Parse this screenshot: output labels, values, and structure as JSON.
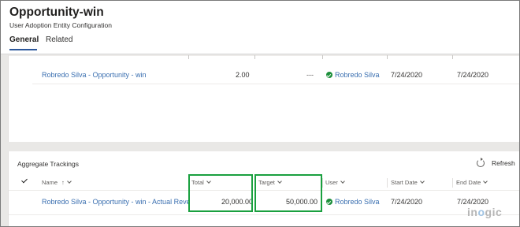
{
  "header": {
    "title": "Opportunity-win",
    "subtitle": "User Adoption Entity Configuration",
    "tabs": [
      {
        "label": "General",
        "active": true
      },
      {
        "label": "Related",
        "active": false
      }
    ]
  },
  "top_grid": {
    "row": {
      "name": "Robredo Silva - Opportunity - win",
      "value": "2.00",
      "target": "---",
      "user": "Robredo Silva",
      "start_date": "7/24/2020",
      "end_date": "7/24/2020"
    }
  },
  "aggregate": {
    "title": "Aggregate Trackings",
    "refresh_label": "Refresh",
    "columns": {
      "name": "Name",
      "name_sort": "↑",
      "total": "Total",
      "target": "Target",
      "user": "User",
      "start_date": "Start Date",
      "end_date": "End Date"
    },
    "row": {
      "name": "Robredo Silva - Opportunity - win - Actual Revenu",
      "total": "20,000.00",
      "target": "50,000.00",
      "user": "Robredo Silva",
      "start_date": "7/24/2020",
      "end_date": "7/24/2020"
    }
  },
  "watermark": {
    "prefix": "in",
    "o": "o",
    "suffix": "gic"
  },
  "colors": {
    "link": "#3a6fb0",
    "status_active": "#1d8f3b",
    "highlight": "#1aa03f",
    "tab_underline": "#2b579a"
  }
}
